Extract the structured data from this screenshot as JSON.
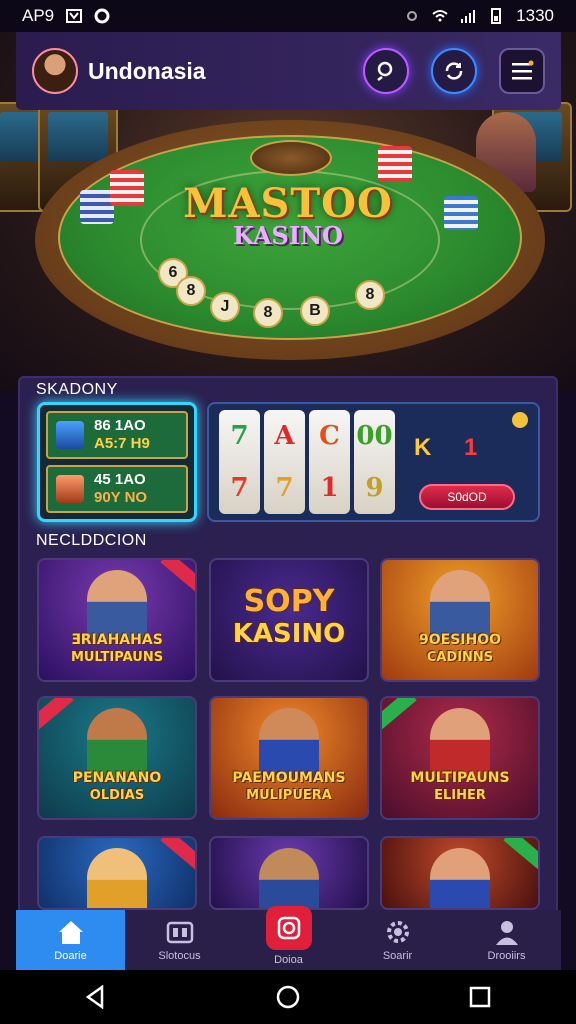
{
  "status_bar": {
    "left_text": "AP9",
    "time": "1330"
  },
  "header": {
    "region": "Undonasia",
    "icons": [
      "avatar",
      "search-icon",
      "refresh-icon",
      "menu-icon"
    ]
  },
  "hero": {
    "logo_line1": "MASTOO",
    "logo_line2": "KASINO",
    "bet_spots": [
      "6",
      "8",
      "J",
      "8",
      "B",
      "8"
    ]
  },
  "featured": {
    "title": "SKADONY",
    "promo": [
      {
        "line1": "86 1AO",
        "line2": "A5:7 H9"
      },
      {
        "line1": "45 1AO",
        "line2": "90Y NO"
      }
    ],
    "slot": {
      "reels": [
        [
          "7",
          "7"
        ],
        [
          "A",
          "7"
        ],
        [
          "C",
          "1"
        ],
        [
          "00",
          "9"
        ]
      ],
      "left_symbol": "K",
      "right_symbol": "1",
      "button": "S0dOD"
    }
  },
  "recommended": {
    "title": "NECLDDCION",
    "games": [
      {
        "line1": "ƎRIAHAHAS",
        "line2": "MULTIPAUNS",
        "style": "normal"
      },
      {
        "line1": "SOPY",
        "line2": "KASINO",
        "style": "big"
      },
      {
        "line1": "9OESIHOO",
        "line2": "CADINNS",
        "style": "normal"
      },
      {
        "line1": "PENANANO",
        "line2": "OLDIAS",
        "style": "normal"
      },
      {
        "line1": "PAEMOUMANS",
        "line2": "MULIPUERA",
        "style": "normal"
      },
      {
        "line1": "MULTIPAUNS",
        "line2": "ELIHER",
        "style": "normal"
      },
      {
        "line1": "",
        "line2": "",
        "style": "normal"
      },
      {
        "line1": "",
        "line2": "",
        "style": "normal"
      },
      {
        "line1": "",
        "line2": "",
        "style": "normal"
      }
    ]
  },
  "bottom_nav": [
    {
      "label": "Doarie",
      "icon": "home-icon",
      "active": true
    },
    {
      "label": "Slotocus",
      "icon": "slots-icon",
      "active": false
    },
    {
      "label": "Doioa",
      "icon": "live-icon",
      "active": false
    },
    {
      "label": "Soarir",
      "icon": "gear-icon",
      "active": false
    },
    {
      "label": "Drooiirs",
      "icon": "profile-icon",
      "active": false
    }
  ],
  "colors": {
    "accent": "#2e8cf0",
    "panel": "#2b2050",
    "gold": "#ffd24a",
    "header": "#2a1c4e"
  }
}
